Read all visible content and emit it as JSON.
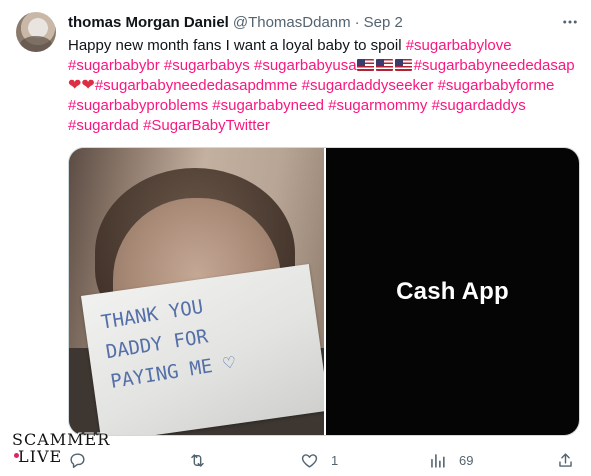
{
  "tweet": {
    "display_name": "thomas Morgan Daniel",
    "handle": "@ThomasDdanm",
    "separator": "·",
    "date": "Sep 2",
    "text_intro": "Happy new month fans I want a loyal baby to spoil ",
    "tags": {
      "t1": "#sugarbabylove",
      "t2": "#sugarbabybr",
      "t3": "#sugarbabys",
      "t4": "#sugarbabyusa",
      "t5": "#sugarbabyneededasap",
      "t6": "#sugarbabyneededasapdmme",
      "t7": "#sugardaddyseeker",
      "t8": "#sugarbabyforme",
      "t9": "#sugarbabyproblems",
      "t10": "#sugarbabyneed",
      "t11": "#sugarmommy",
      "t12": "#sugardaddys",
      "t13": "#sugardad",
      "t14": "#SugarBabyTwitter"
    },
    "emoji": {
      "flag": "us-flag-emoji",
      "heart": "❤",
      "heart_icon": "red-heart-emoji"
    },
    "hashtag_color": "#f91880"
  },
  "media": {
    "photo_note_lines": [
      "THANK YOU",
      "DADDY FOR",
      "PAYING ME ♡"
    ],
    "cashapp_label": "Cash App"
  },
  "actions": {
    "reply_count": "",
    "retweet_count": "",
    "like_count": "1",
    "views_count": "69",
    "icons": [
      "reply-icon",
      "retweet-icon",
      "like-icon",
      "views-icon",
      "share-icon"
    ]
  },
  "watermark": {
    "line1": "SCAMMER",
    "line2": "LIVE"
  },
  "colors": {
    "text": "#0f1419",
    "secondary": "#536471",
    "border": "#cfd9de",
    "cashapp_bg": "#050505"
  }
}
